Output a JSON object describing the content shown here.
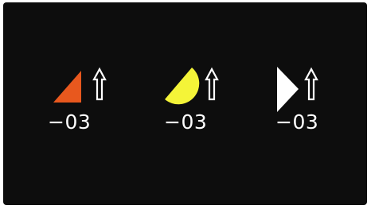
{
  "pieces": [
    {
      "shape": "triangle-icon",
      "color": "#e8581e",
      "direction": "up-arrow-icon",
      "value": "−03"
    },
    {
      "shape": "half-circle-icon",
      "color": "#f4f438",
      "direction": "up-arrow-icon",
      "value": "−03"
    },
    {
      "shape": "right-pointing-triangle-icon",
      "color": "#ffffff",
      "direction": "up-arrow-icon",
      "value": "−03"
    }
  ],
  "colors": {
    "background": "#0d0d0d",
    "text": "#ffffff",
    "arrow": "#ffffff"
  }
}
